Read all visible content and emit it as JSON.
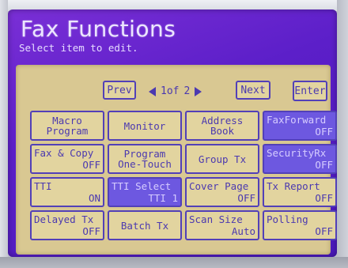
{
  "title": "Fax Functions",
  "subtitle": "Select item to edit.",
  "nav": {
    "prev_label": "Prev",
    "page_text": "1of",
    "page_total": "2",
    "next_label": "Next",
    "enter_label": "Enter"
  },
  "grid": [
    {
      "id": "macro-program",
      "lines": [
        "Macro",
        "Program"
      ],
      "style": "center2"
    },
    {
      "id": "monitor",
      "lines": [
        "Monitor"
      ],
      "style": "center1"
    },
    {
      "id": "address-book",
      "lines": [
        "Address",
        "Book"
      ],
      "style": "center2"
    },
    {
      "id": "fax-forward",
      "top": "FaxForward",
      "bot": "OFF",
      "style": "split",
      "selected": true
    },
    {
      "id": "fax-and-copy",
      "top": "Fax & Copy",
      "bot": "OFF",
      "style": "split"
    },
    {
      "id": "program-one-touch",
      "lines": [
        "Program",
        "One-Touch"
      ],
      "style": "center2"
    },
    {
      "id": "group-tx",
      "lines": [
        "Group Tx"
      ],
      "style": "center1"
    },
    {
      "id": "security-rx",
      "top": "SecurityRx",
      "bot": "OFF",
      "style": "split",
      "selected": true
    },
    {
      "id": "tti",
      "top": "TTI",
      "bot": "ON",
      "style": "split"
    },
    {
      "id": "tti-select",
      "top": "TTI Select",
      "bot": "TTI 1",
      "style": "split",
      "selected": true
    },
    {
      "id": "cover-page",
      "top": "Cover Page",
      "bot": "OFF",
      "style": "split"
    },
    {
      "id": "tx-report",
      "top": "Tx Report",
      "bot": "OFF",
      "style": "split"
    },
    {
      "id": "delayed-tx",
      "top": "Delayed Tx",
      "bot": "OFF",
      "style": "split"
    },
    {
      "id": "batch-tx",
      "lines": [
        "Batch Tx"
      ],
      "style": "center1"
    },
    {
      "id": "scan-size",
      "top": "Scan Size",
      "bot": "Auto",
      "style": "split"
    },
    {
      "id": "polling",
      "top": "Polling",
      "bot": "OFF",
      "style": "split"
    }
  ],
  "colors": {
    "screen_purple": "#5c1fc9",
    "panel_tan": "#d9c892",
    "button_text": "#4b39b0",
    "selected_button": "#6d58e0"
  }
}
